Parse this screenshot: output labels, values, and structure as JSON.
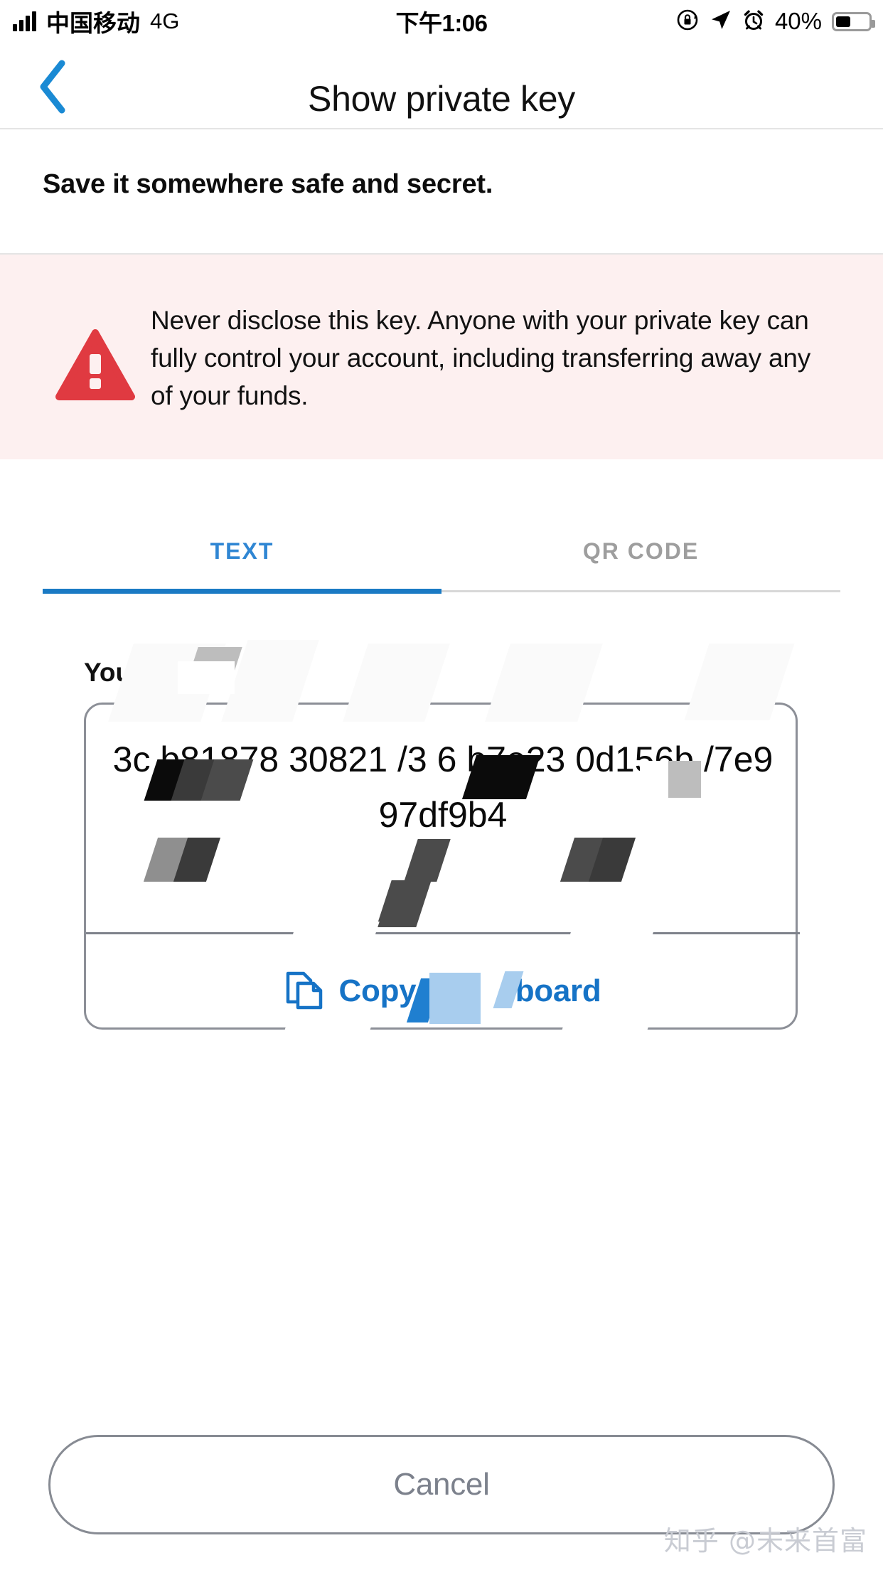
{
  "statusbar": {
    "carrier": "中国移动",
    "network": "4G",
    "time": "下午1:06",
    "battery_percent": "40%",
    "icons": [
      "signal-bars-icon",
      "rotation-lock-icon",
      "location-arrow-icon",
      "alarm-clock-icon",
      "battery-icon"
    ]
  },
  "navbar": {
    "title": "Show private key",
    "back_icon": "chevron-left-icon",
    "back_color": "#1a8ad4"
  },
  "header": {
    "subtitle": "Save it somewhere safe and secret."
  },
  "warning": {
    "icon": "warning-triangle-icon",
    "icon_color": "#E03A41",
    "background": "#FDF0F0",
    "text": "Never disclose this key. Anyone with your private key can fully control your account, including transferring away any of your funds."
  },
  "tabs": {
    "items": [
      {
        "label": "TEXT",
        "active": true
      },
      {
        "label": "QR CODE",
        "active": false
      }
    ],
    "active_color": "#2f86d3",
    "inactive_color": "#9e9e9e",
    "indicator_color": "#1a7ac4"
  },
  "key_section": {
    "label": "Your private key",
    "value": "3c     b81878     30821     /3  6    b7e23    0d156b    /7e9     97df9b4",
    "copy": {
      "label": "Copy to clipboard",
      "icon": "copy-icon",
      "color": "#1673c6"
    }
  },
  "footer": {
    "cancel_label": "Cancel"
  },
  "watermark": {
    "text": "知乎 @未来首富"
  }
}
